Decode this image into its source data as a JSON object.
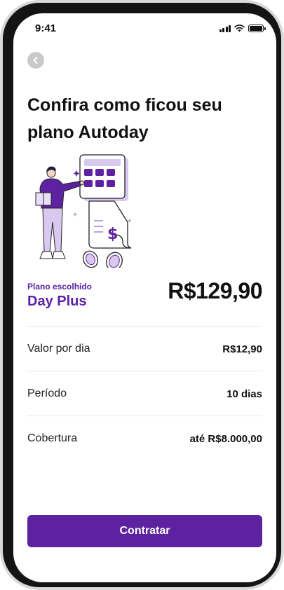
{
  "status_bar": {
    "time": "9:41"
  },
  "header": {
    "title": "Confira como ficou seu plano Autoday"
  },
  "plan": {
    "label": "Plano escolhido",
    "name": "Day Plus",
    "price": "R$129,90"
  },
  "details": [
    {
      "label": "Valor por dia",
      "value": "R$12,90"
    },
    {
      "label": "Período",
      "value": "10 dias"
    },
    {
      "label": "Cobertura",
      "value": "até R$8.000,00"
    }
  ],
  "cta": {
    "label": "Contratar"
  },
  "colors": {
    "accent": "#5d22a0",
    "accent_light": "#d9c9ef"
  }
}
